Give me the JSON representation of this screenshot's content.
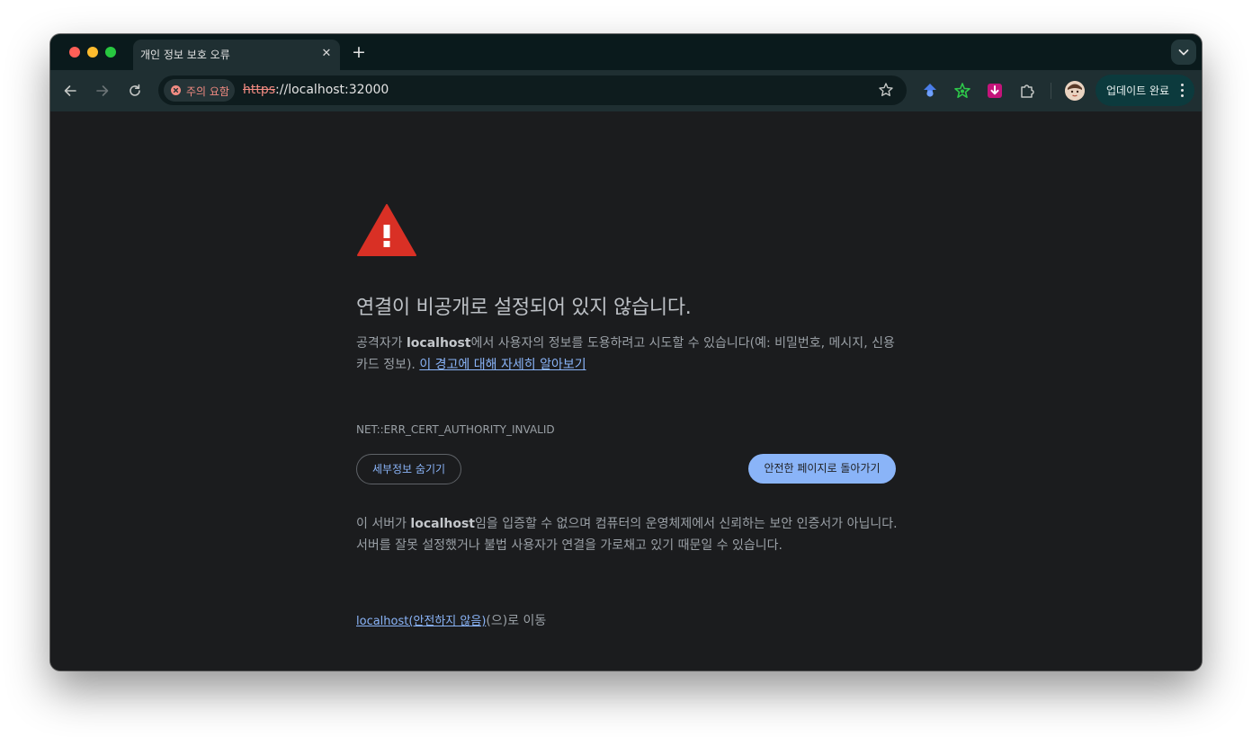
{
  "tab": {
    "title": "개인 정보 보호 오류",
    "close_label": "✕",
    "new_tab_label": "+"
  },
  "toolbar": {
    "security_chip": "주의 요함",
    "url_scheme": "https",
    "url_rest": "://localhost:32000",
    "update_button": "업데이트 완료"
  },
  "icons": {
    "back": "arrow-left-icon",
    "forward": "arrow-right-icon",
    "reload": "reload-icon",
    "bookmark": "star-icon",
    "extensions": "puzzle-icon",
    "menu": "kebab-icon",
    "warning": "warning-triangle-icon"
  },
  "page": {
    "heading": "연결이 비공개로 설정되어 있지 않습니다.",
    "para1_before": "공격자가 ",
    "para1_host": "localhost",
    "para1_after": "에서 사용자의 정보를 도용하려고 시도할 수 있습니다(예: 비밀번호, 메시지, 신용카드 정보). ",
    "learn_more_link": "이 경고에 대해 자세히 알아보기",
    "error_code": "NET::ERR_CERT_AUTHORITY_INVALID",
    "details_button": "세부정보 숨기기",
    "back_button": "안전한 페이지로 돌아가기",
    "para2_before": "이 서버가 ",
    "para2_host": "localhost",
    "para2_after": "임을 입증할 수 없으며 컴퓨터의 운영체제에서 신뢰하는 보안 인증서가 아닙니다. 서버를 잘못 설정했거나 불법 사용자가 연결을 가로채고 있기 때문일 수 있습니다.",
    "proceed_link": "localhost(안전하지 않음)",
    "proceed_suffix": "(으)로 이동"
  },
  "colors": {
    "warning_red": "#d93025",
    "link_blue": "#8ab4f8",
    "primary_button": "#8ab4f8",
    "background": "#1b1c1e"
  }
}
